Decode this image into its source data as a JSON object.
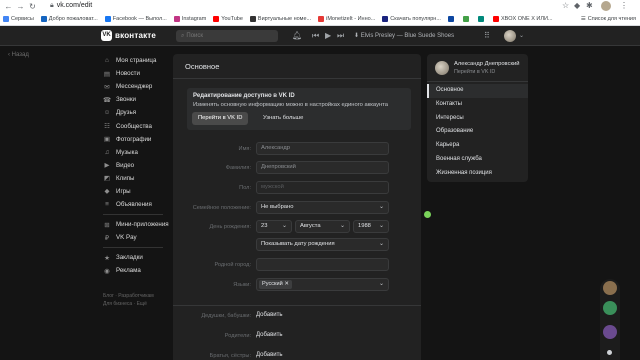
{
  "browser": {
    "url": "vk.com/edit",
    "bookmarks": [
      {
        "label": "Сервисы",
        "color": "#4285f4"
      },
      {
        "label": "Добро пожаловат...",
        "color": "#1565c0"
      },
      {
        "label": "Facebook — Выпол...",
        "color": "#1877f2"
      },
      {
        "label": "Instagram",
        "color": "#c13584"
      },
      {
        "label": "YouTube",
        "color": "#ff0000"
      },
      {
        "label": "Виртуальные номе...",
        "color": "#333333"
      },
      {
        "label": "iMonetizeIt - Инно...",
        "color": "#e53935"
      },
      {
        "label": "Скачать популярн...",
        "color": "#1a237e"
      },
      {
        "label": "",
        "color": "#0d47a1"
      },
      {
        "label": "",
        "color": "#43a047"
      },
      {
        "label": "",
        "color": "#00897b"
      },
      {
        "label": "XBOX ONE X ИЛИ...",
        "color": "#ff0000"
      }
    ],
    "other_bookmarks": "Список для чтения"
  },
  "header": {
    "logo_mark": "VK",
    "logo_text": "вконтакте",
    "search_placeholder": "Поиск",
    "track": "Elvis Presley — Blue Suede Shoes"
  },
  "back_label": "Назад",
  "left_menu": {
    "group1": [
      {
        "icon": "⌂",
        "label": "Моя страница"
      },
      {
        "icon": "▤",
        "label": "Новости"
      },
      {
        "icon": "✉",
        "label": "Мессенджер"
      },
      {
        "icon": "☎",
        "label": "Звонки"
      },
      {
        "icon": "☺",
        "label": "Друзья"
      },
      {
        "icon": "☷",
        "label": "Сообщества"
      },
      {
        "icon": "▣",
        "label": "Фотографии"
      },
      {
        "icon": "♫",
        "label": "Музыка"
      },
      {
        "icon": "▶",
        "label": "Видео"
      },
      {
        "icon": "◩",
        "label": "Клипы"
      },
      {
        "icon": "◆",
        "label": "Игры"
      },
      {
        "icon": "≡",
        "label": "Объявления"
      }
    ],
    "group2": [
      {
        "icon": "⊞",
        "label": "Мини-приложения"
      },
      {
        "icon": "₽",
        "label": "VK Pay"
      }
    ],
    "group3": [
      {
        "icon": "★",
        "label": "Закладки"
      },
      {
        "icon": "◉",
        "label": "Реклама"
      }
    ],
    "footer": {
      "line1": "Блог · Разработчикам",
      "line2": "Для бизнеса · Ещё"
    }
  },
  "main": {
    "title": "Основное",
    "notice": {
      "title": "Редактирование доступно в VK ID",
      "text": "Изменять основную информацию можно в настройках единого аккаунта",
      "primary_button": "Перейти в VK ID",
      "secondary_button": "Узнать больше"
    },
    "form": {
      "first_name_label": "Имя:",
      "first_name": "Александр",
      "last_name_label": "Фамилия:",
      "last_name": "Днепровский",
      "gender_label": "Пол:",
      "gender": "мужской",
      "marital_label": "Семейное положение:",
      "marital": "Не выбрано",
      "birthday_label": "День рождения:",
      "birth_day": "23",
      "birth_month": "Августа",
      "birth_year": "1988",
      "birthday_visibility": "Показывать дату рождения",
      "hometown_label": "Родной город:",
      "languages_label": "Языки:",
      "language_chip": "Русский",
      "relatives": [
        {
          "label": "Дедушки, бабушки:",
          "action": "Добавить"
        },
        {
          "label": "Родители:",
          "action": "Добавить"
        },
        {
          "label": "Братья, сёстры:",
          "action": "Добавить"
        }
      ]
    }
  },
  "right_nav": {
    "name": "Александр Днепровский",
    "vkid_link": "Перейти в VK ID",
    "items": [
      "Основное",
      "Контакты",
      "Интересы",
      "Образование",
      "Карьера",
      "Военная служба",
      "Жизненная позиция"
    ],
    "selected": "Основное"
  }
}
